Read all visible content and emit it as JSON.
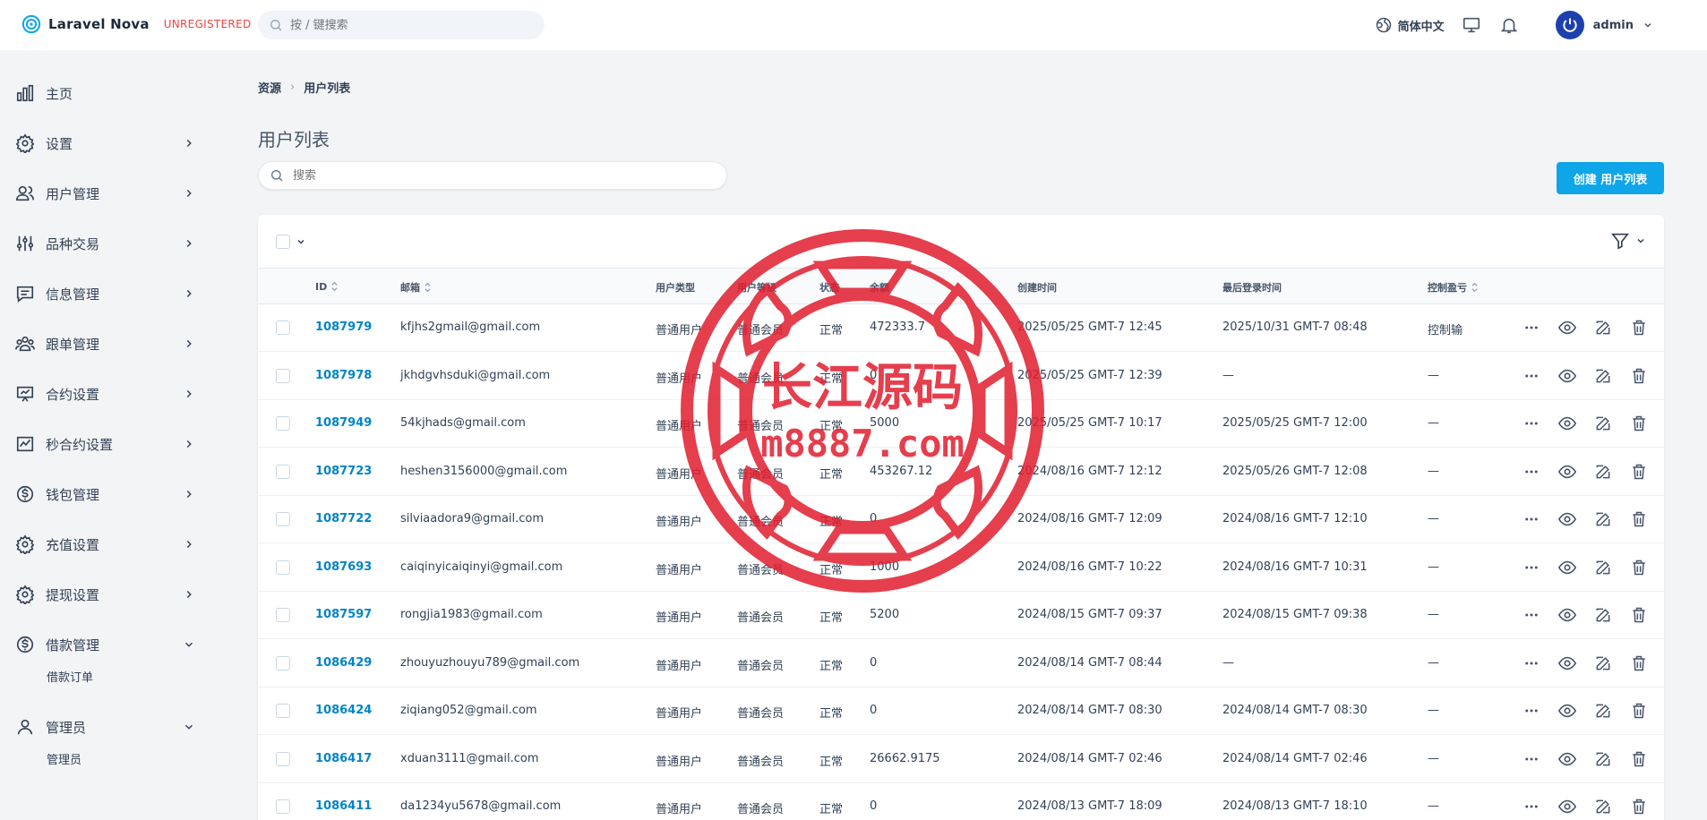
{
  "app": {
    "name": "Laravel Nova",
    "badge": "UNREGISTERED"
  },
  "header": {
    "search_placeholder": "按 / 键搜索",
    "language": "简体中文",
    "user_name": "admin"
  },
  "sidebar": {
    "items": [
      {
        "label": "主页",
        "icon": "chart-bar-icon",
        "has_chevron": false
      },
      {
        "label": "设置",
        "icon": "cog-icon",
        "has_chevron": true
      },
      {
        "label": "用户管理",
        "icon": "users-icon",
        "has_chevron": true
      },
      {
        "label": "品种交易",
        "icon": "adjustments-icon",
        "has_chevron": true
      },
      {
        "label": "信息管理",
        "icon": "chat-icon",
        "has_chevron": true
      },
      {
        "label": "跟单管理",
        "icon": "user-group-icon",
        "has_chevron": true
      },
      {
        "label": "合约设置",
        "icon": "presentation-icon",
        "has_chevron": true
      },
      {
        "label": "秒合约设置",
        "icon": "trend-chart-icon",
        "has_chevron": true
      },
      {
        "label": "钱包管理",
        "icon": "currency-icon",
        "has_chevron": true
      },
      {
        "label": "充值设置",
        "icon": "cog-icon",
        "has_chevron": true
      },
      {
        "label": "提现设置",
        "icon": "cog-icon",
        "has_chevron": true
      },
      {
        "label": "借款管理",
        "icon": "currency-icon",
        "has_chevron": true,
        "expanded": true,
        "sub": "借款订单"
      },
      {
        "label": "管理员",
        "icon": "user-icon",
        "has_chevron": true,
        "expanded": true,
        "sub": "管理员"
      }
    ]
  },
  "breadcrumb": {
    "root": "资源",
    "current": "用户列表"
  },
  "page": {
    "title": "用户列表",
    "search_placeholder": "搜索",
    "create_label": "创建 用户列表"
  },
  "table": {
    "columns": {
      "id": "ID",
      "email": "邮箱",
      "user_type": "用户类型",
      "user_level": "用户等级",
      "status": "状态",
      "balance": "余额",
      "created": "创建时间",
      "last_login": "最后登录时间",
      "control": "控制盈亏"
    },
    "rows": [
      {
        "id": "1087979",
        "email": "kfjhs2gmail@gmail.com",
        "type": "普通用户",
        "level": "普通会员",
        "status": "正常",
        "balance": "472333.7",
        "created": "2025/05/25 GMT-7 12:45",
        "last_login": "2025/10/31 GMT-7 08:48",
        "control": "控制输"
      },
      {
        "id": "1087978",
        "email": "jkhdgvhsduki@gmail.com",
        "type": "普通用户",
        "level": "普通会员",
        "status": "正常",
        "balance": "0",
        "created": "2025/05/25 GMT-7 12:39",
        "last_login": "—",
        "control": "—"
      },
      {
        "id": "1087949",
        "email": "54kjhads@gmail.com",
        "type": "普通用户",
        "level": "普通会员",
        "status": "正常",
        "balance": "5000",
        "created": "2025/05/25 GMT-7 10:17",
        "last_login": "2025/05/25 GMT-7 12:00",
        "control": "—"
      },
      {
        "id": "1087723",
        "email": "heshen3156000@gmail.com",
        "type": "普通用户",
        "level": "普通会员",
        "status": "正常",
        "balance": "453267.12",
        "created": "2024/08/16 GMT-7 12:12",
        "last_login": "2025/05/26 GMT-7 12:08",
        "control": "—"
      },
      {
        "id": "1087722",
        "email": "silviaadora9@gmail.com",
        "type": "普通用户",
        "level": "普通会员",
        "status": "正常",
        "balance": "0",
        "created": "2024/08/16 GMT-7 12:09",
        "last_login": "2024/08/16 GMT-7 12:10",
        "control": "—"
      },
      {
        "id": "1087693",
        "email": "caiqinyicaiqinyi@gmail.com",
        "type": "普通用户",
        "level": "普通会员",
        "status": "正常",
        "balance": "1000",
        "created": "2024/08/16 GMT-7 10:22",
        "last_login": "2024/08/16 GMT-7 10:31",
        "control": "—"
      },
      {
        "id": "1087597",
        "email": "rongjia1983@gmail.com",
        "type": "普通用户",
        "level": "普通会员",
        "status": "正常",
        "balance": "5200",
        "created": "2024/08/15 GMT-7 09:37",
        "last_login": "2024/08/15 GMT-7 09:38",
        "control": "—"
      },
      {
        "id": "1086429",
        "email": "zhouyuzhouyu789@gmail.com",
        "type": "普通用户",
        "level": "普通会员",
        "status": "正常",
        "balance": "0",
        "created": "2024/08/14 GMT-7 08:44",
        "last_login": "—",
        "control": "—"
      },
      {
        "id": "1086424",
        "email": "ziqiang052@gmail.com",
        "type": "普通用户",
        "level": "普通会员",
        "status": "正常",
        "balance": "0",
        "created": "2024/08/14 GMT-7 08:30",
        "last_login": "2024/08/14 GMT-7 08:30",
        "control": "—"
      },
      {
        "id": "1086417",
        "email": "xduan3111@gmail.com",
        "type": "普通用户",
        "level": "普通会员",
        "status": "正常",
        "balance": "26662.9175",
        "created": "2024/08/14 GMT-7 02:46",
        "last_login": "2024/08/14 GMT-7 02:46",
        "control": "—"
      },
      {
        "id": "1086411",
        "email": "da1234yu5678@gmail.com",
        "type": "普通用户",
        "level": "普通会员",
        "status": "正常",
        "balance": "0",
        "created": "2024/08/13 GMT-7 18:09",
        "last_login": "2024/08/13 GMT-7 18:10",
        "control": "—"
      }
    ]
  },
  "watermark": {
    "line1": "长江源码",
    "line2": "m8887.com",
    "color": "#e11d2e"
  },
  "colors": {
    "accent": "#0ea5e9",
    "link": "#0284c7",
    "brand": "#0ea5e9",
    "danger": "#ef4444"
  }
}
